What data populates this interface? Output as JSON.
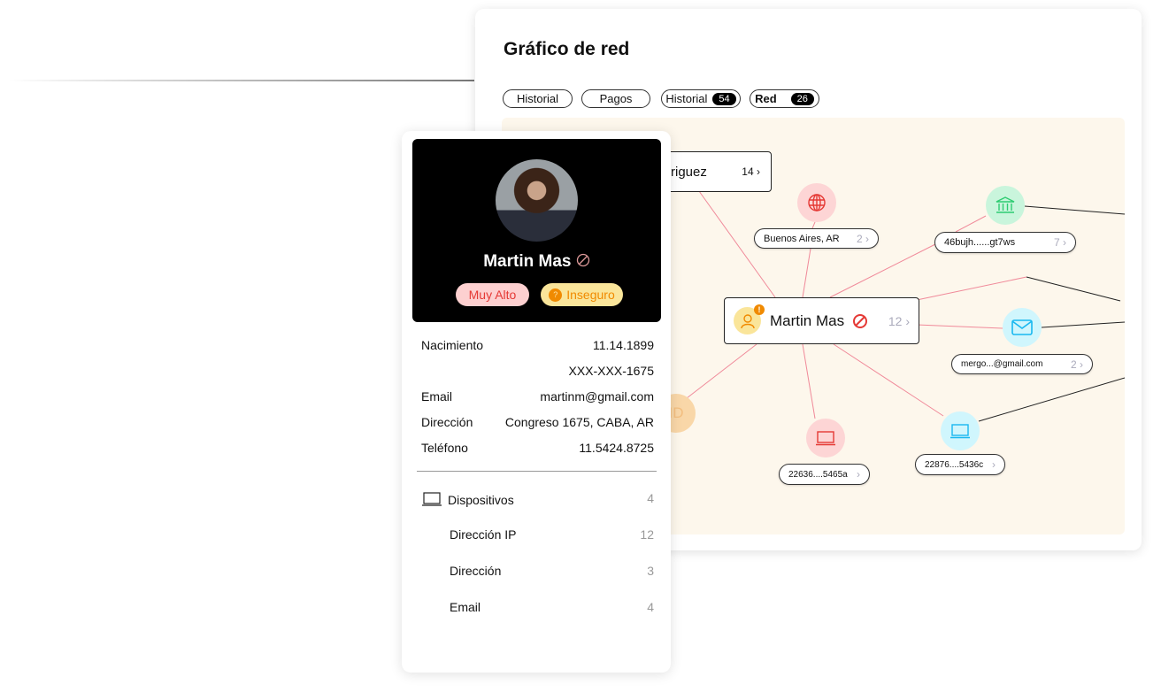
{
  "header": {
    "title": "Gráfico de red"
  },
  "tabs": [
    {
      "label": "Historial"
    },
    {
      "label": "Pagos"
    },
    {
      "label": "Historial",
      "count": "54"
    },
    {
      "label": "Red",
      "count": "26",
      "active": true
    }
  ],
  "graph": {
    "center": {
      "name": "Martin Mas",
      "count": "12",
      "icon": "user-icon",
      "status": "blocked"
    },
    "rodriguez": {
      "name": "riguez",
      "count": "14"
    },
    "nodes": [
      {
        "label": "Buenos Aires, AR",
        "count": "2",
        "icon": "globe-icon",
        "color": "#e53935"
      },
      {
        "label": "46bujh......gt7ws",
        "count": "7",
        "icon": "bank-icon",
        "color": "#2ecc71"
      },
      {
        "label": "mergo...@gmail.com",
        "count": "2",
        "icon": "mail-icon",
        "color": "#19b8f0"
      },
      {
        "label": "22636....5465a",
        "icon": "laptop-icon",
        "color": "#e53935"
      },
      {
        "label": "22876....5436c",
        "icon": "laptop-icon",
        "color": "#19b8f0"
      }
    ],
    "id_node": "ID"
  },
  "profile": {
    "name": "Martin Mas",
    "badges": [
      {
        "label": "Muy Alto"
      },
      {
        "label": "Inseguro",
        "icon": "?"
      }
    ],
    "fields": [
      {
        "label": "Nacimiento",
        "value": "11.14.1899"
      },
      {
        "label": "",
        "value": "XXX-XXX-1675"
      },
      {
        "label": "Email",
        "value": "martinm@gmail.com"
      },
      {
        "label": "Dirección",
        "value": "Congreso 1675, CABA, AR"
      },
      {
        "label": "Teléfono",
        "value": "11.5424.8725"
      }
    ],
    "links": [
      {
        "label": "Dispositivos",
        "count": "4"
      },
      {
        "label": "Dirección IP",
        "count": "12"
      },
      {
        "label": "Dirección",
        "count": "3"
      },
      {
        "label": "Email",
        "count": "4"
      }
    ]
  },
  "colors": {
    "graph_bg": "#fdf7ec",
    "edge": "#f08a9a",
    "danger": "#e53935"
  }
}
